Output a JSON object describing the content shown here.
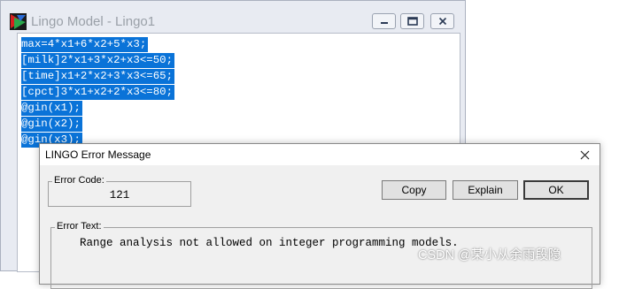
{
  "model_window": {
    "title": "Lingo Model - Lingo1",
    "code_lines": [
      "max=4*x1+6*x2+5*x3;",
      "[milk]2*x1+3*x2+x3<=50;",
      "[time]x1+2*x2+3*x3<=65;",
      "[cpct]3*x1+x2+2*x3<=80;",
      "@gin(x1);",
      "@gin(x2);",
      "@gin(x3);"
    ]
  },
  "error_dialog": {
    "title": "LINGO Error Message",
    "error_code_label": "Error Code:",
    "error_code": "121",
    "error_text_label": "Error Text:",
    "error_text": "Range analysis not allowed on integer programming models.",
    "buttons": {
      "copy": "Copy",
      "explain": "Explain",
      "ok": "OK"
    }
  },
  "watermark": "CSDN @某小从余雨段隐",
  "colors": {
    "selection": "#0a73d8",
    "window_frame": "#e8ebf2"
  },
  "icons": [
    "lingo-app-icon",
    "minimize-icon",
    "maximize-icon",
    "close-icon"
  ]
}
